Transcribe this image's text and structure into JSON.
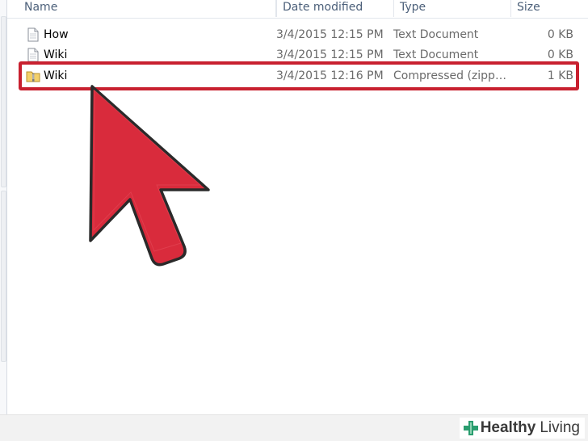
{
  "columns": {
    "name": "Name",
    "date_modified": "Date modified",
    "type": "Type",
    "size": "Size"
  },
  "files": [
    {
      "name": "How",
      "date": "3/4/2015 12:15 PM",
      "type": "Text Document",
      "size": "0 KB",
      "icon": "text-document-icon"
    },
    {
      "name": "Wiki",
      "date": "3/4/2015 12:15 PM",
      "type": "Text Document",
      "size": "0 KB",
      "icon": "text-document-icon"
    },
    {
      "name": "Wiki",
      "date": "3/4/2015 12:16 PM",
      "type": "Compressed (zipp…",
      "size": "1 KB",
      "icon": "zip-folder-icon",
      "highlighted": true
    }
  ],
  "highlight_color": "#c8202f",
  "arrow_color": "#d92b3c",
  "watermark": {
    "part1": "Healthy",
    "part2": "Living"
  }
}
